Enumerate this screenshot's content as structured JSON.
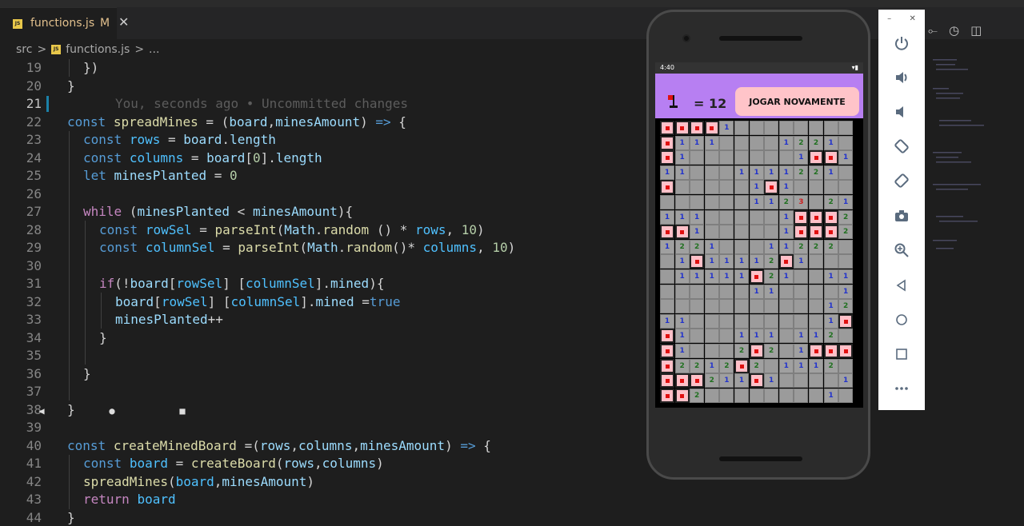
{
  "tab": {
    "icon_text": "JS",
    "label": "functions.js",
    "modified": "M",
    "close": "✕"
  },
  "breadcrumb": [
    "src",
    "functions.js",
    "..."
  ],
  "breadcrumb_sep": ">",
  "blame": "You, seconds ago • Uncommitted changes",
  "line_numbers": [
    "19",
    "20",
    "21",
    "22",
    "23",
    "24",
    "25",
    "26",
    "27",
    "28",
    "29",
    "30",
    "31",
    "32",
    "33",
    "34",
    "35",
    "36",
    "37",
    "38",
    "39",
    "40",
    "41",
    "42",
    "43",
    "44"
  ],
  "current_line": "21",
  "emulator": {
    "close": "✕",
    "minimize": "–"
  },
  "app": {
    "flag_count": "= 12",
    "play_again": "JOGAR NOVAMENTE",
    "status_time": "4:40"
  },
  "board": {
    "cols": 13,
    "rows_data": [
      "FFFF1........",
      "F111....1221.",
      "F1.......1FF1",
      "11...1111221.",
      "F.....1F1....",
      "......1123.21",
      "111.....1FFF2",
      "FF1.....1FFF2",
      "1221...11222.",
      ".1F11112F1...",
      ".11111F21..11",
      "......11....1F",
      "...........12F",
      "11.........1F1",
      "F1...111.112.",
      "F1...2F2.1FFF",
      "F2212F2.1112.",
      "FFF211F1....1",
      "FF2........1."
    ]
  }
}
